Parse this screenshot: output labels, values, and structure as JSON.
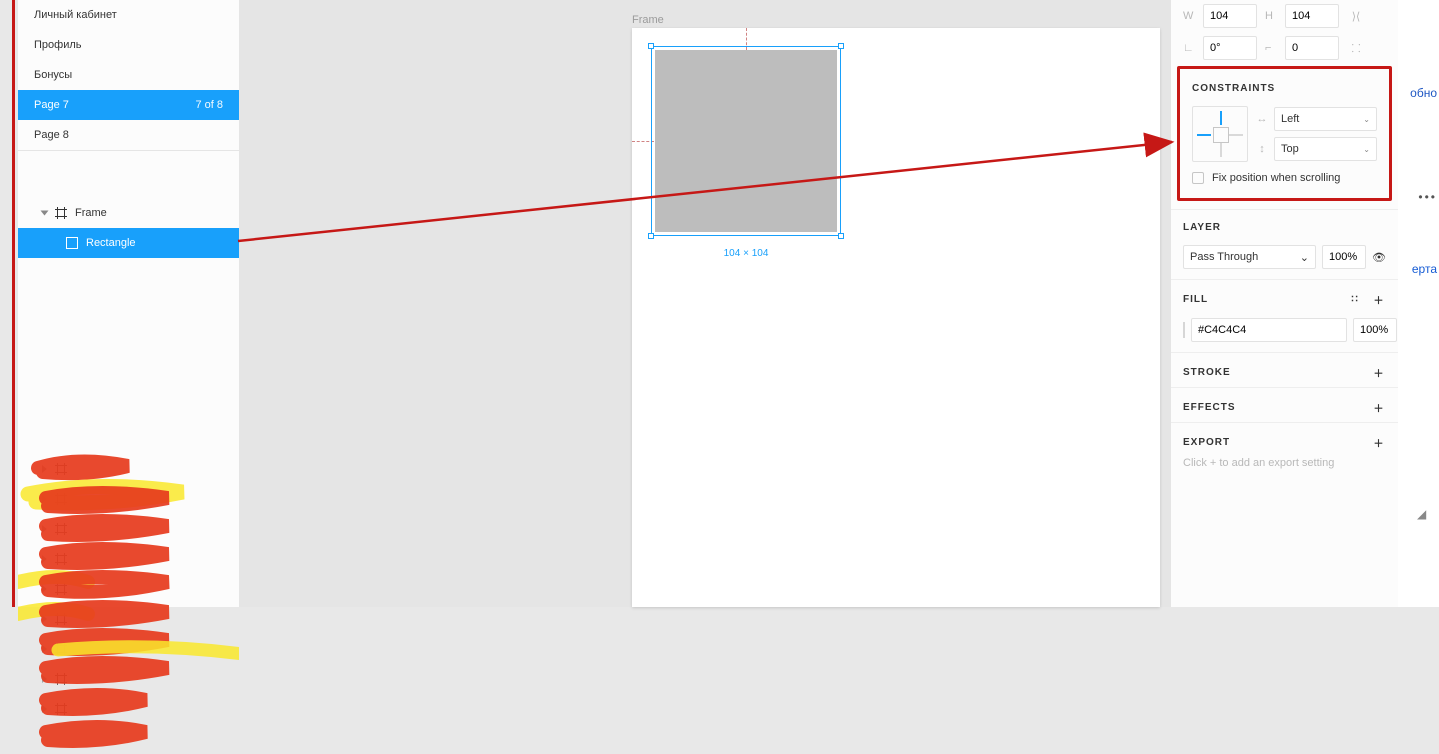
{
  "pages": {
    "items": [
      {
        "label": "Личный кабинет"
      },
      {
        "label": "Профиль"
      },
      {
        "label": "Бонусы"
      },
      {
        "label": "Page 7",
        "sub": "7 of 8",
        "selected": true
      },
      {
        "label": "Page 8"
      }
    ]
  },
  "layers": {
    "root": {
      "label": "Frame"
    },
    "selected": {
      "label": "Rectangle"
    }
  },
  "canvas": {
    "frame_label": "Frame",
    "selection_dims": "104 × 104"
  },
  "props": {
    "w_label": "W",
    "w": "104",
    "h_label": "H",
    "h": "104",
    "rot_label": "⟳",
    "rot": "0°",
    "radius_label": "⌐",
    "radius": "0"
  },
  "constraints": {
    "title": "CONSTRAINTS",
    "horizontal": "Left",
    "vertical": "Top",
    "fix_label": "Fix position when scrolling"
  },
  "layer_section": {
    "title": "LAYER",
    "mode": "Pass Through",
    "opacity": "100%"
  },
  "fill": {
    "title": "FILL",
    "hex": "#C4C4C4",
    "opacity": "100%"
  },
  "stroke": {
    "title": "STROKE"
  },
  "effects": {
    "title": "EFFECTS"
  },
  "export": {
    "title": "EXPORT",
    "hint": "Click + to add an export setting"
  },
  "browser_strip": {
    "t1": "обно",
    "t2": "ерта",
    "ell": "•••"
  }
}
